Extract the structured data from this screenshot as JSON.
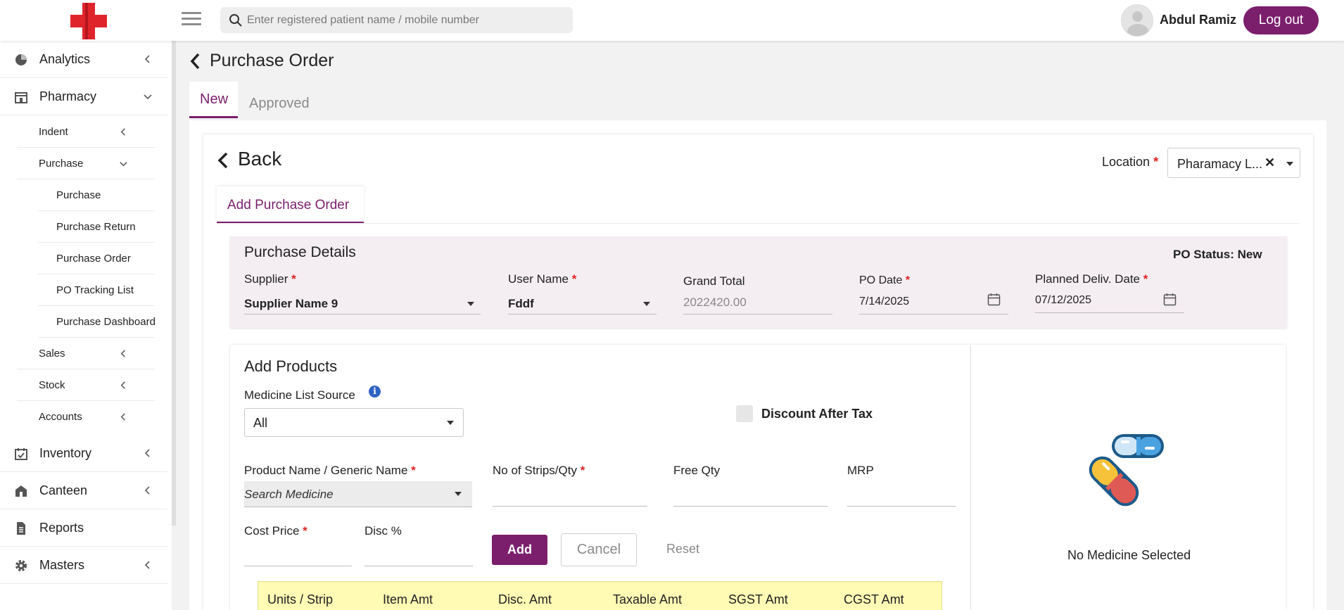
{
  "header": {
    "search_placeholder": "Enter registered patient name / mobile number",
    "user_name": "Abdul Ramiz",
    "logout_label": "Log out"
  },
  "sidebar": {
    "analytics": "Analytics",
    "pharmacy": "Pharmacy",
    "indent": "Indent",
    "purchase_group": "Purchase",
    "purchase": "Purchase",
    "purchase_return": "Purchase Return",
    "purchase_order": "Purchase Order",
    "po_tracking": "PO Tracking List",
    "purchase_dashboard": "Purchase Dashboard",
    "sales": "Sales",
    "stock": "Stock",
    "accounts": "Accounts",
    "inventory": "Inventory",
    "canteen": "Canteen",
    "reports": "Reports",
    "masters": "Masters"
  },
  "page": {
    "title": "Purchase Order",
    "tab_new": "New",
    "tab_approved": "Approved",
    "back_label": "Back",
    "location_label": "Location",
    "location_value": "Pharamacy L...",
    "sub_tab": "Add Purchase Order"
  },
  "purchase_details": {
    "title": "Purchase Details",
    "po_status": "PO Status: New",
    "supplier_label": "Supplier",
    "supplier_value": "Supplier Name 9",
    "username_label": "User Name",
    "username_value": "Fddf",
    "grand_total_label": "Grand Total",
    "grand_total_value": "2022420.00",
    "po_date_label": "PO Date",
    "po_date_value": "7/14/2025",
    "planned_date_label": "Planned Deliv. Date",
    "planned_date_value": "07/12/2025"
  },
  "add_products": {
    "title": "Add Products",
    "source_label": "Medicine List Source",
    "source_value": "All",
    "discount_after_tax": "Discount After Tax",
    "product_label": "Product Name / Generic Name",
    "product_placeholder": "Search Medicine",
    "strips_label": "No of Strips/Qty",
    "free_qty_label": "Free Qty",
    "mrp_label": "MRP",
    "cost_price_label": "Cost Price",
    "disc_label": "Disc %",
    "add_button": "Add",
    "cancel_button": "Cancel",
    "reset_button": "Reset",
    "table_headers": [
      "Units / Strip",
      "Item Amt",
      "Disc. Amt",
      "Taxable Amt",
      "SGST Amt",
      "CGST Amt"
    ]
  },
  "preview": {
    "empty_text": "No Medicine Selected"
  },
  "colors": {
    "brand": "#7b1e6c",
    "required": "#e02424",
    "logo_red": "#e0242c"
  }
}
